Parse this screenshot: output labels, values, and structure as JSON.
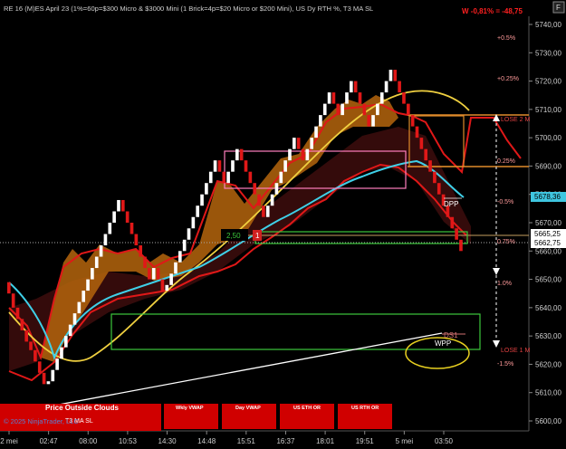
{
  "header": {
    "title": "RE 16 (M)ES April 23 (1%=60p=$300 Micro & $3000 Mini  (1 Brick=4p=$20 Micro or $200 Mini), US Dy RTH %, T3 MA SL",
    "pnl": "W -0,81% = -48,75",
    "close_button": "F"
  },
  "price_axis": {
    "ticks": [
      "5740,00",
      "5730,00",
      "5720,00",
      "5710,00",
      "5700,00",
      "5690,00",
      "5680,00",
      "5670,00",
      "5660,00",
      "5650,00",
      "5640,00",
      "5630,00",
      "5620,00",
      "5610,00",
      "5600,00"
    ],
    "current_labels": [
      {
        "text": "5678,36",
        "bg": "#3fc6e0"
      },
      {
        "text": "5665,25",
        "bg": "#ffffff"
      },
      {
        "text": "5662,75",
        "bg": "#ffffff"
      }
    ]
  },
  "time_axis": [
    "2 mei",
    "02:47",
    "08:00",
    "10:53",
    "14:30",
    "14:48",
    "15:51",
    "16:37",
    "18:01",
    "19:51",
    "5 mei",
    "03:50"
  ],
  "percent_labels": [
    "+0.5%",
    "+0.25%",
    "0.25%",
    "-0.5%",
    "0.75%",
    "1.0%",
    "-1.5%"
  ],
  "chart_annotations": {
    "lose_2": "LOSE 2 M",
    "lose_1": "LOSE 1 M",
    "dpp": "DPP",
    "ds1": "DS1",
    "wpp": "WPP",
    "marker_value": "2,50",
    "marker_tag": "1",
    "price_outside": "Price Outside Clouds",
    "t3_sl": "T3 MA SL"
  },
  "buttons": [
    "Wkly VWAP",
    "Day VWAP",
    "US ETH OR",
    "US RTH OR"
  ],
  "copyright": "© 2025 NinjaTrader, LLC",
  "colors": {
    "background": "#000000",
    "bull_brick": "#ffffff",
    "bear_brick": "#e01818",
    "cloud": "#b5650d",
    "vwap": "#3fd0e8",
    "ma_yellow": "#f0d040",
    "button_red": "#d00000"
  },
  "chart_data": {
    "type": "renko",
    "brick_size": 4,
    "price_range": [
      5600,
      5745
    ],
    "closing_prices": [
      5645,
      5640,
      5636,
      5632,
      5628,
      5625,
      5621,
      5617,
      5613,
      5614,
      5618,
      5622,
      5626,
      5630,
      5634,
      5638,
      5642,
      5646,
      5650,
      5654,
      5658,
      5662,
      5666,
      5670,
      5674,
      5678,
      5674,
      5670,
      5666,
      5662,
      5658,
      5654,
      5650,
      5654,
      5650,
      5646,
      5648,
      5652,
      5656,
      5660,
      5664,
      5668,
      5672,
      5676,
      5680,
      5684,
      5688,
      5692,
      5688,
      5684,
      5688,
      5692,
      5696,
      5692,
      5688,
      5684,
      5680,
      5676,
      5672,
      5676,
      5680,
      5684,
      5688,
      5692,
      5696,
      5700,
      5696,
      5692,
      5696,
      5700,
      5704,
      5708,
      5712,
      5716,
      5712,
      5708,
      5712,
      5716,
      5720,
      5716,
      5712,
      5708,
      5704,
      5708,
      5712,
      5716,
      5720,
      5724,
      5720,
      5716,
      5712,
      5708,
      5704,
      5700,
      5696,
      5692,
      5688,
      5684,
      5680,
      5676,
      5672,
      5668,
      5664,
      5660
    ]
  }
}
